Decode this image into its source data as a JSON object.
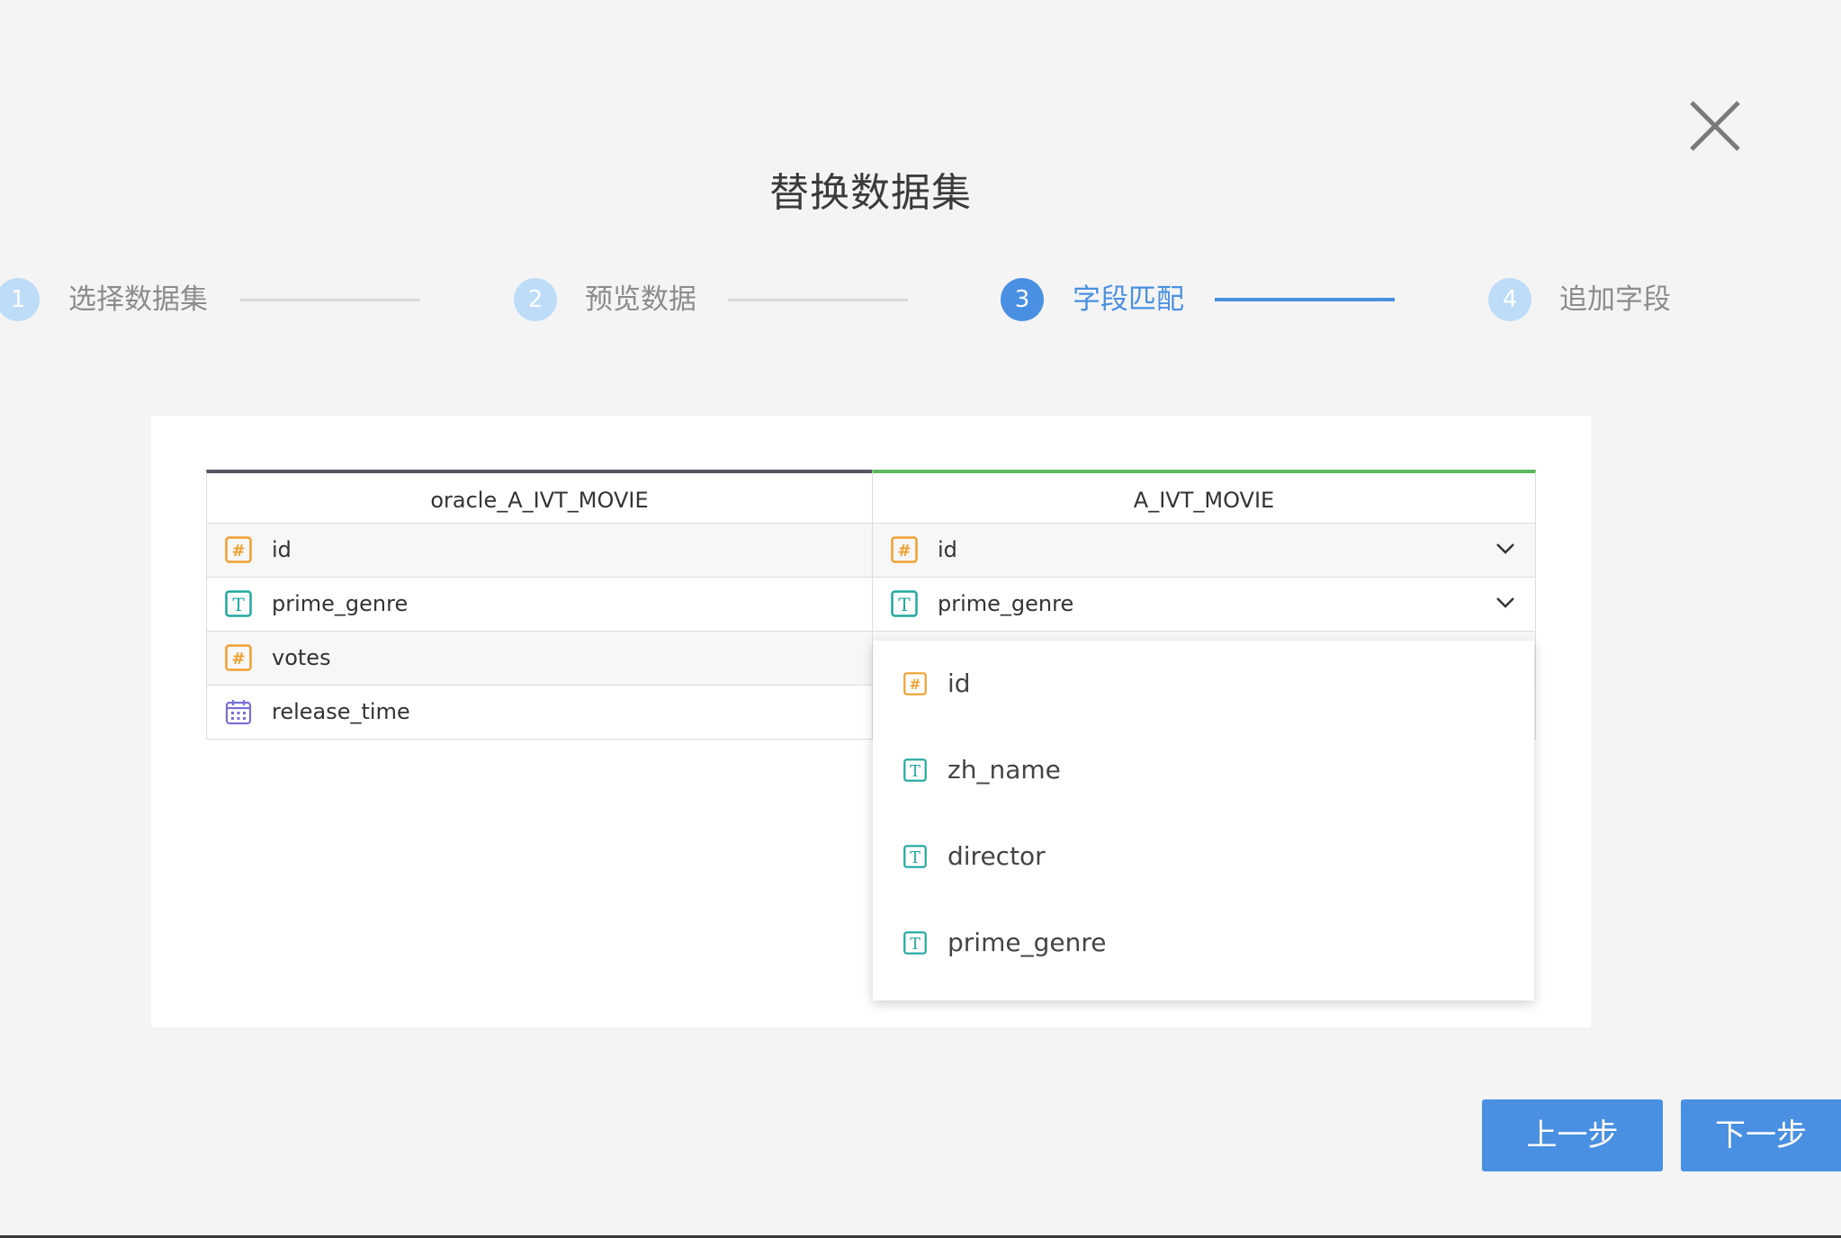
{
  "dialog": {
    "title": "替换数据集",
    "close_icon": "close-icon"
  },
  "steps": [
    {
      "number": "1",
      "label": "选择数据集",
      "state": "pending"
    },
    {
      "number": "2",
      "label": "预览数据",
      "state": "pending"
    },
    {
      "number": "3",
      "label": "字段匹配",
      "state": "active"
    },
    {
      "number": "4",
      "label": "追加字段",
      "state": "pending"
    }
  ],
  "mapping": {
    "source_header": "oracle_A_IVT_MOVIE",
    "target_header": "A_IVT_MOVIE",
    "rows": [
      {
        "source": "id",
        "source_type": "number",
        "target": "id",
        "target_type": "number"
      },
      {
        "source": "prime_genre",
        "source_type": "text",
        "target": "prime_genre",
        "target_type": "text"
      },
      {
        "source": "votes",
        "source_type": "number"
      },
      {
        "source": "release_time",
        "source_type": "date"
      }
    ]
  },
  "dropdown": {
    "options": [
      {
        "label": "id",
        "type": "number"
      },
      {
        "label": "zh_name",
        "type": "text"
      },
      {
        "label": "director",
        "type": "text"
      },
      {
        "label": "prime_genre",
        "type": "text"
      }
    ]
  },
  "footer": {
    "prev_label": "上一步",
    "next_label": "下一步"
  },
  "colors": {
    "accent": "#4a90e2",
    "number_icon": "#f0a030",
    "text_icon": "#1fa8a0",
    "date_icon": "#7a6fd6",
    "source_header_bar": "#555566",
    "target_header_bar": "#5cb85c"
  }
}
